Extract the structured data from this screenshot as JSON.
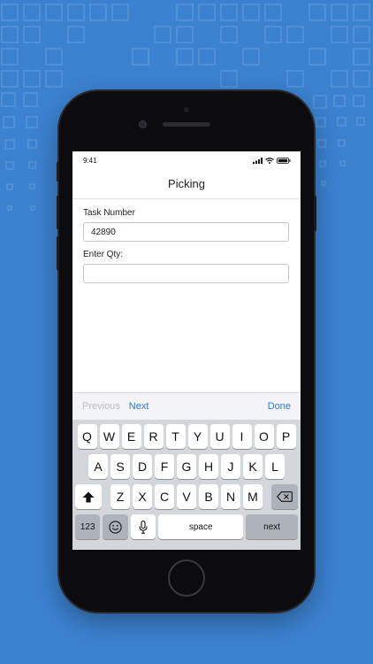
{
  "status_bar": {
    "time": "9:41"
  },
  "nav": {
    "title": "Picking"
  },
  "form": {
    "task_number_label": "Task Number",
    "task_number_value": "42890",
    "qty_label": "Enter Qty:",
    "qty_value": ""
  },
  "accessory": {
    "previous": "Previous",
    "next": "Next",
    "done": "Done"
  },
  "keyboard": {
    "row1": [
      "Q",
      "W",
      "E",
      "R",
      "T",
      "Y",
      "U",
      "I",
      "O",
      "P"
    ],
    "row2": [
      "A",
      "S",
      "D",
      "F",
      "G",
      "H",
      "J",
      "K",
      "L"
    ],
    "row3": [
      "Z",
      "X",
      "C",
      "V",
      "B",
      "N",
      "M"
    ],
    "numbers": "123",
    "space": "space",
    "return": "next"
  },
  "icons": {
    "shift": "shift-icon",
    "delete": "delete-icon",
    "emoji": "emoji-icon",
    "mic": "microphone-icon",
    "signal": "signal-icon",
    "wifi": "wifi-icon",
    "battery": "battery-icon"
  },
  "colors": {
    "background": "#3b82d0",
    "accent": "#2f7bd6",
    "keyboard": "#d3d6db"
  }
}
